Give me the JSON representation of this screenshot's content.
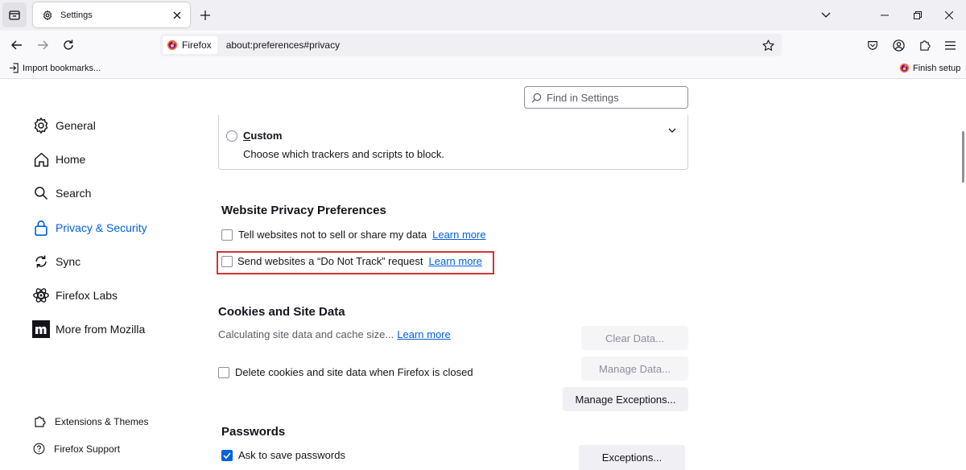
{
  "window": {
    "tab_title": "Settings",
    "new_tab_symbol": "+"
  },
  "nav": {
    "identity_label": "Firefox",
    "url": "about:preferences#privacy"
  },
  "bookmarks": {
    "import_label": "Import bookmarks...",
    "finish_setup_label": "Finish setup"
  },
  "search": {
    "placeholder": "Find in Settings"
  },
  "sidebar": {
    "items": [
      {
        "label": "General",
        "icon": "gear-icon"
      },
      {
        "label": "Home",
        "icon": "home-icon"
      },
      {
        "label": "Search",
        "icon": "search-icon"
      },
      {
        "label": "Privacy & Security",
        "icon": "lock-icon",
        "selected": true
      },
      {
        "label": "Sync",
        "icon": "sync-icon"
      },
      {
        "label": "Firefox Labs",
        "icon": "labs-icon"
      },
      {
        "label": "More from Mozilla",
        "icon": "mozilla-icon"
      }
    ],
    "footer": [
      {
        "label": "Extensions & Themes",
        "icon": "puzzle-icon"
      },
      {
        "label": "Firefox Support",
        "icon": "help-icon"
      }
    ]
  },
  "tracking": {
    "custom_title_first": "C",
    "custom_title_rest": "ustom",
    "custom_desc": "Choose which trackers and scripts to block."
  },
  "privacy_prefs": {
    "heading": "Website Privacy Preferences",
    "gpc_label": "Tell websites not to sell or share my data",
    "gpc_link": "Learn more",
    "dnt_label": "Send websites a “Do Not Track” request",
    "dnt_link": "Learn more"
  },
  "cookies": {
    "heading": "Cookies and Site Data",
    "status_text": "Calculating site data and cache size...",
    "status_link": "Learn more",
    "delete_on_close_label": "Delete cookies and site data when Firefox is closed",
    "clear_data_button": "Clear Data...",
    "manage_data_button": "Manage Data...",
    "manage_exceptions_button": "Manage Exceptions..."
  },
  "passwords": {
    "heading": "Passwords",
    "ask_to_save_label": "Ask to save passwords",
    "ask_to_save_checked": true,
    "exceptions_button": "Exceptions..."
  },
  "colors": {
    "accent": "#0061e0",
    "highlight_border": "#d0343a"
  }
}
